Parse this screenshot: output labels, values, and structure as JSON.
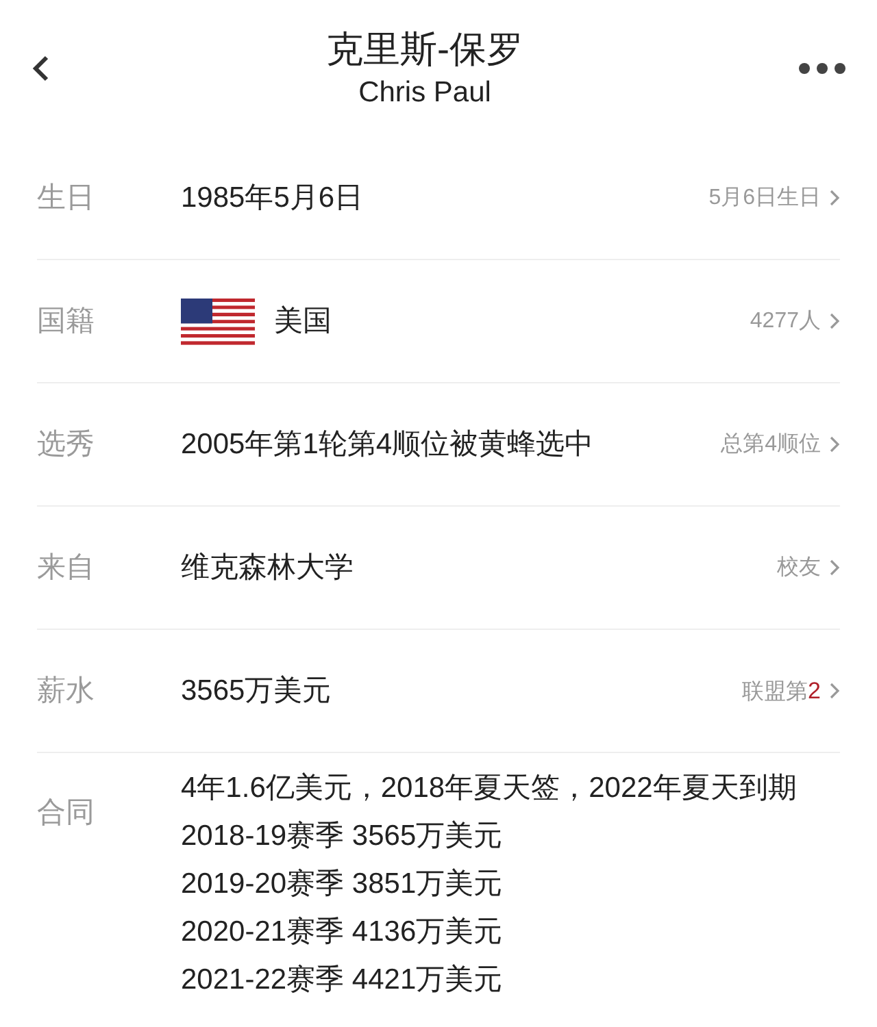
{
  "header": {
    "title": "克里斯-保罗",
    "subtitle": "Chris Paul"
  },
  "rows": [
    {
      "label": "生日",
      "kind": "text",
      "value": "1985年5月6日",
      "link": {
        "text": "5月6日生日"
      }
    },
    {
      "label": "国籍",
      "kind": "flag",
      "value": "美国",
      "link": {
        "text": "4277人"
      }
    },
    {
      "label": "选秀",
      "kind": "text",
      "value": "2005年第1轮第4顺位被黄蜂选中",
      "link": {
        "text": "总第4顺位"
      }
    },
    {
      "label": "来自",
      "kind": "text",
      "value": "维克森林大学",
      "link": {
        "text": "校友"
      }
    },
    {
      "label": "薪水",
      "kind": "text",
      "value": "3565万美元",
      "link": {
        "text": "联盟第",
        "highlight": "2"
      }
    }
  ],
  "contract": {
    "label": "合同",
    "lines": [
      "4年1.6亿美元，2018年夏天签，2022年夏天到期",
      "2018-19赛季 3565万美元",
      "2019-20赛季 3851万美元",
      "2020-21赛季 4136万美元",
      "2021-22赛季 4421万美元"
    ]
  }
}
